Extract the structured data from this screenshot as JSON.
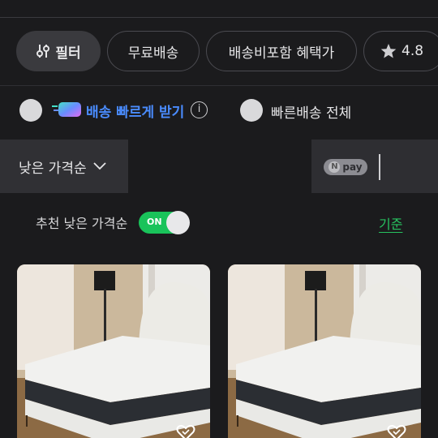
{
  "filters": {
    "filter_label": "필터",
    "free_shipping_label": "무료배송",
    "bundle_label": "배송비포함 혜택가",
    "rating_label": "4.8"
  },
  "delivery": {
    "fast_label_bold": "배송",
    "fast_label_rest": "빠르게 받기",
    "info_glyph": "i",
    "all_label": "빠른배송 전체"
  },
  "sort": {
    "selected": "낮은 가격순"
  },
  "pay": {
    "badge_text": "pay",
    "badge_n": "N"
  },
  "recommend": {
    "label": "추천 낮은 가격순",
    "toggle_state": "ON",
    "criteria_link": "기준"
  },
  "products": [
    {
      "image": "mattress-bed-photo",
      "liked": false
    },
    {
      "image": "mattress-bed-photo",
      "liked": false
    }
  ],
  "colors": {
    "background": "#1b1b1d",
    "toggle_on": "#19c35a",
    "link": "#27c25f",
    "fast_delivery": "#4a8cff"
  }
}
